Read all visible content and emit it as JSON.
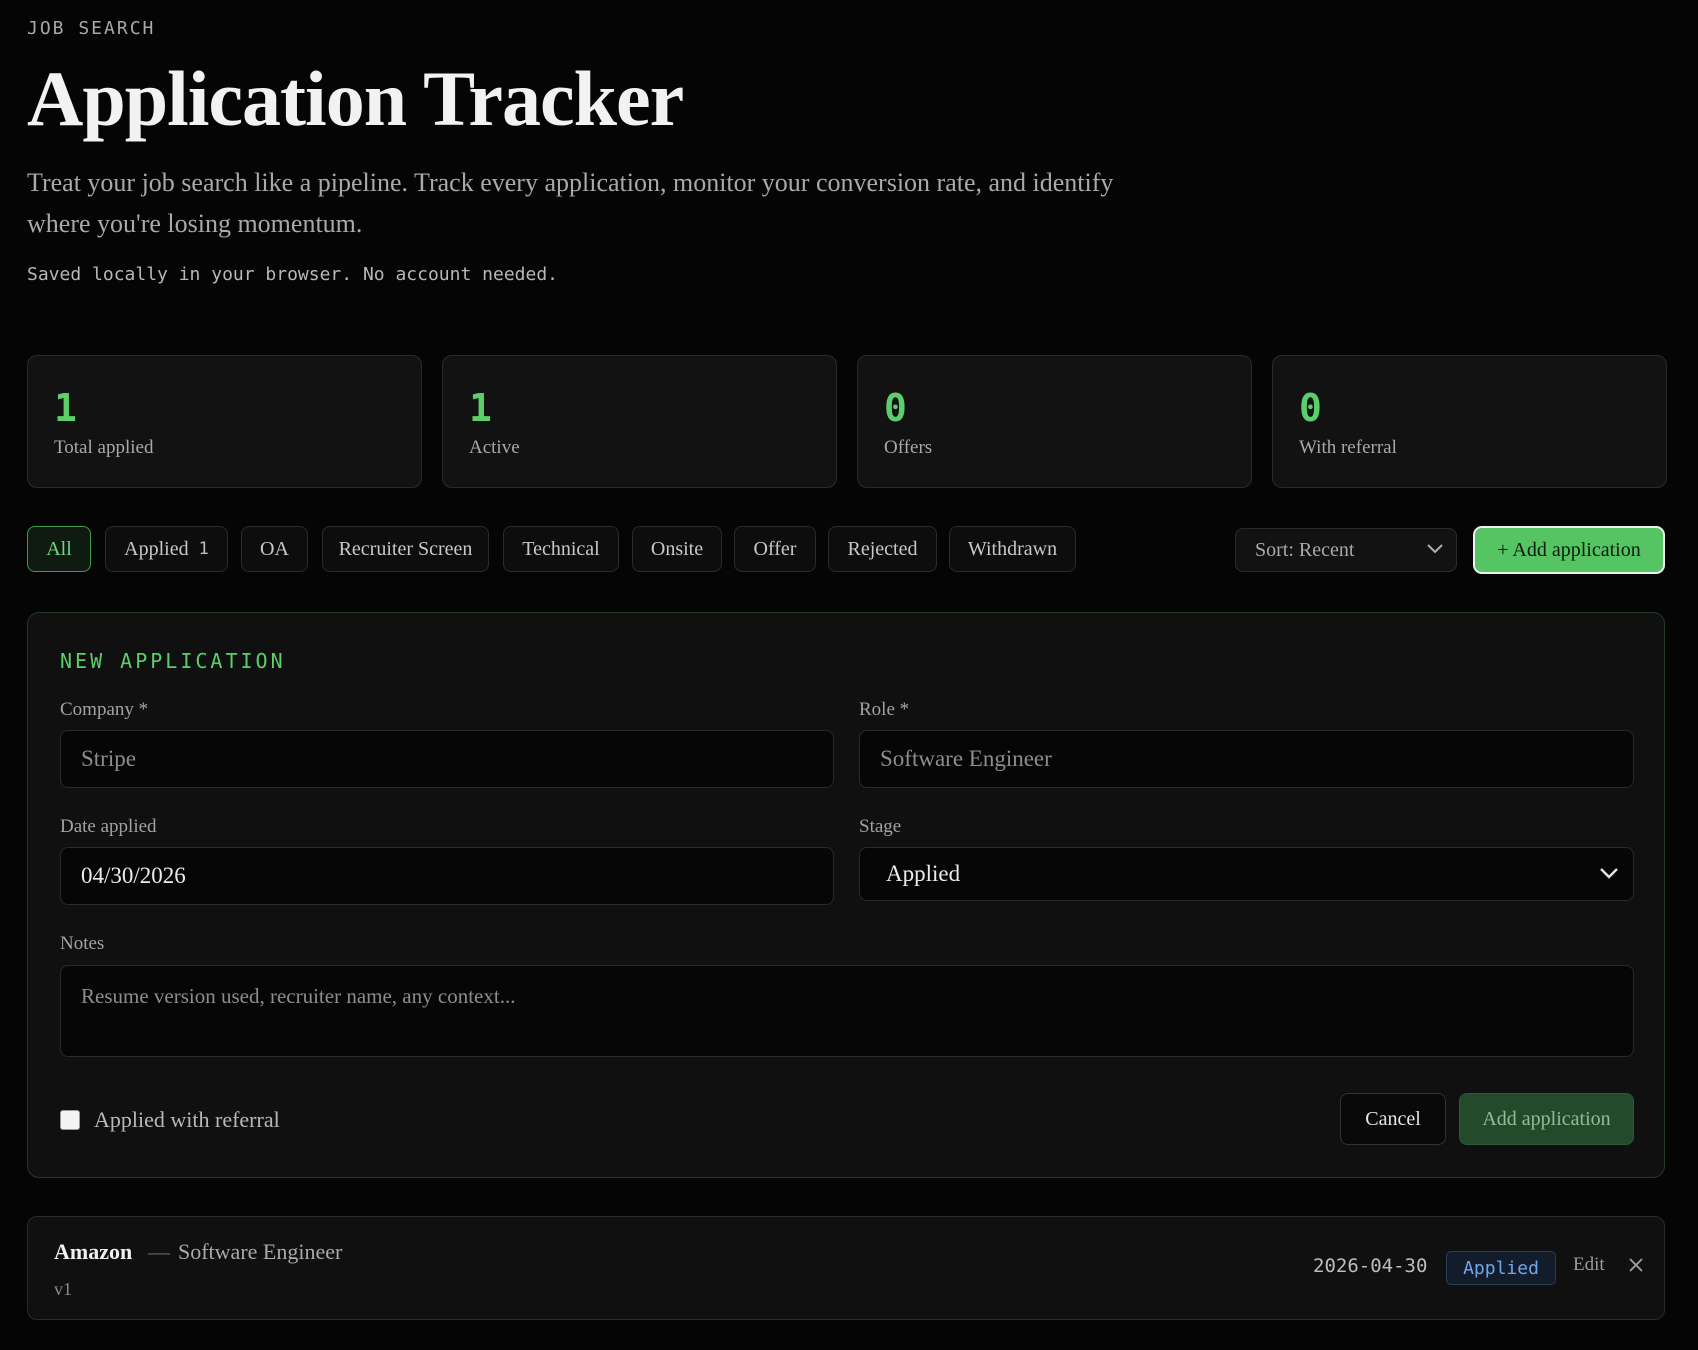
{
  "header": {
    "eyebrow": "JOB SEARCH",
    "title": "Application Tracker",
    "subtitle": "Treat your job search like a pipeline. Track every application, monitor your conversion rate, and identify where you're losing momentum.",
    "saved_note": "Saved locally in your browser. No account needed."
  },
  "stats": [
    {
      "value": "1",
      "label": "Total applied"
    },
    {
      "value": "1",
      "label": "Active"
    },
    {
      "value": "0",
      "label": "Offers"
    },
    {
      "value": "0",
      "label": "With referral"
    }
  ],
  "filters": [
    {
      "label": "All",
      "active": true
    },
    {
      "label": "Applied",
      "count": "1"
    },
    {
      "label": "OA"
    },
    {
      "label": "Recruiter Screen"
    },
    {
      "label": "Technical"
    },
    {
      "label": "Onsite"
    },
    {
      "label": "Offer"
    },
    {
      "label": "Rejected"
    },
    {
      "label": "Withdrawn"
    }
  ],
  "toolbar": {
    "sort_label": "Sort: Recent",
    "add_label": "+ Add application"
  },
  "form": {
    "title": "NEW APPLICATION",
    "company_label": "Company *",
    "company_placeholder": "Stripe",
    "role_label": "Role *",
    "role_placeholder": "Software Engineer",
    "date_label": "Date applied",
    "date_value": "04/30/2026",
    "stage_label": "Stage",
    "stage_value": "Applied",
    "notes_label": "Notes",
    "notes_placeholder": "Resume version used, recruiter name, any context...",
    "referral_label": "Applied with referral",
    "referral_checked": false,
    "cancel_label": "Cancel",
    "submit_label": "Add application"
  },
  "applications": [
    {
      "company": "Amazon",
      "separator": "—",
      "role": "Software Engineer",
      "note": "v1",
      "date": "2026-04-30",
      "stage": "Applied",
      "edit_label": "Edit"
    }
  ],
  "colors": {
    "accent": "#5ccf6a",
    "badge_blue": "#6ea7f0",
    "background": "#050505"
  }
}
